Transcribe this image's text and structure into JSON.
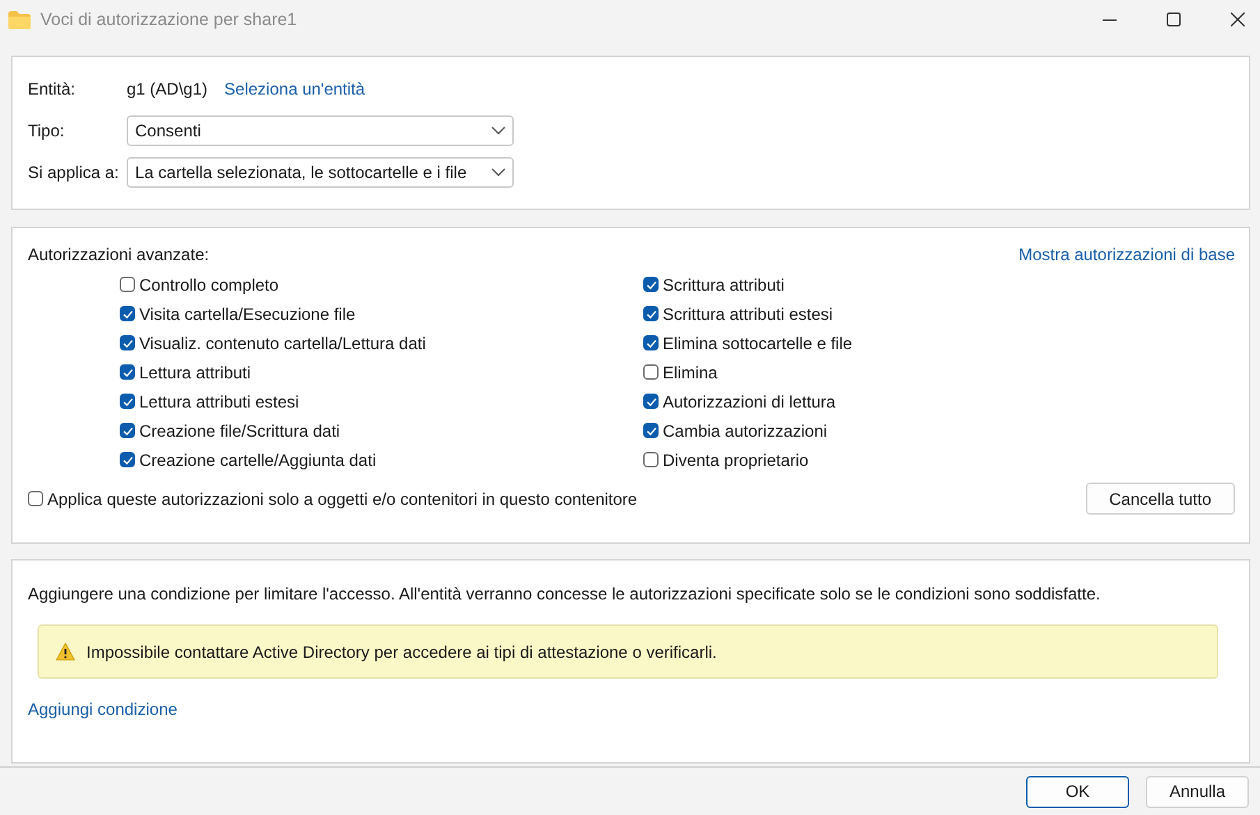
{
  "window": {
    "title": "Voci di autorizzazione per share1"
  },
  "principal": {
    "label": "Entità:",
    "value": "g1 (AD\\g1)",
    "link": "Seleziona un'entità"
  },
  "type": {
    "label": "Tipo:",
    "value": "Consenti"
  },
  "applies_to": {
    "label": "Si applica a:",
    "value": "La cartella selezionata, le sottocartelle e i file"
  },
  "permissions": {
    "title": "Autorizzazioni avanzate:",
    "link": "Mostra autorizzazioni di base",
    "columns": [
      [
        {
          "label": "Controllo completo",
          "checked": false
        },
        {
          "label": "Visita cartella/Esecuzione file",
          "checked": true
        },
        {
          "label": "Visualiz. contenuto cartella/Lettura dati",
          "checked": true
        },
        {
          "label": "Lettura attributi",
          "checked": true
        },
        {
          "label": "Lettura attributi estesi",
          "checked": true
        },
        {
          "label": "Creazione file/Scrittura dati",
          "checked": true
        },
        {
          "label": "Creazione cartelle/Aggiunta dati",
          "checked": true
        }
      ],
      [
        {
          "label": "Scrittura attributi",
          "checked": true
        },
        {
          "label": "Scrittura attributi estesi",
          "checked": true
        },
        {
          "label": "Elimina sottocartelle e file",
          "checked": true
        },
        {
          "label": "Elimina",
          "checked": false
        },
        {
          "label": "Autorizzazioni di lettura",
          "checked": true
        },
        {
          "label": "Cambia autorizzazioni",
          "checked": true
        },
        {
          "label": "Diventa proprietario",
          "checked": false
        }
      ]
    ],
    "apply_only": {
      "label": "Applica queste autorizzazioni solo a oggetti e/o contenitori in questo contenitore",
      "checked": false
    },
    "clear_button": "Cancella tutto"
  },
  "conditions": {
    "description": "Aggiungere una condizione per limitare l'accesso. All'entità verranno concesse le autorizzazioni specificate solo se le condizioni sono soddisfatte.",
    "warning": "Impossibile contattare Active Directory per accedere ai tipi di attestazione o verificarli.",
    "link": "Aggiungi condizione"
  },
  "buttons": [
    {
      "label": "OK",
      "default": true
    },
    {
      "label": "Annulla",
      "default": false
    }
  ]
}
